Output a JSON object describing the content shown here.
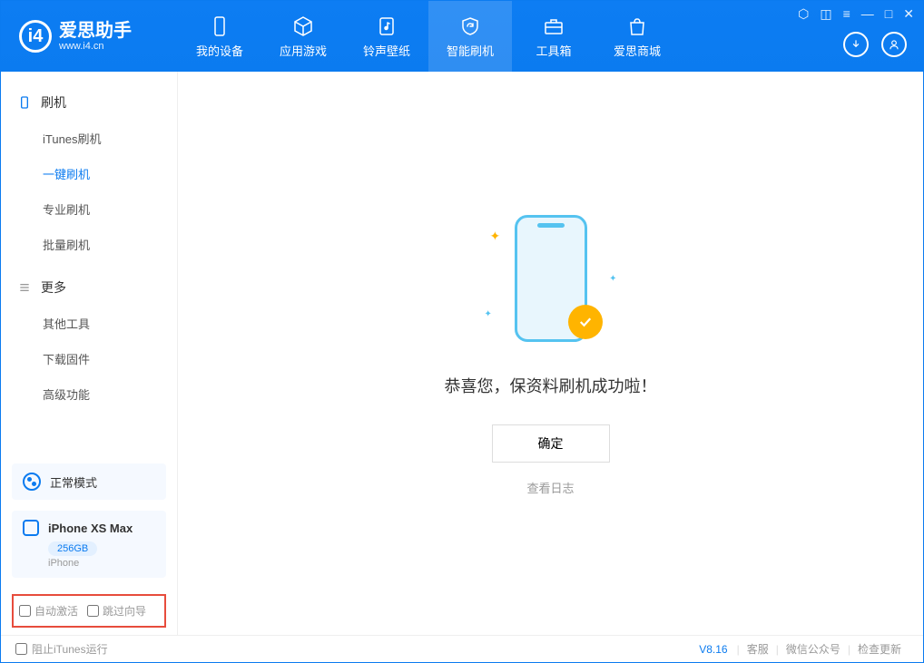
{
  "logo": {
    "title": "爱思助手",
    "subtitle": "www.i4.cn"
  },
  "tabs": {
    "device": "我的设备",
    "apps": "应用游戏",
    "ringtone": "铃声壁纸",
    "flash": "智能刷机",
    "toolbox": "工具箱",
    "store": "爱思商城"
  },
  "sidebar": {
    "section1_title": "刷机",
    "items1": {
      "itunes": "iTunes刷机",
      "onekey": "一键刷机",
      "pro": "专业刷机",
      "batch": "批量刷机"
    },
    "section2_title": "更多",
    "items2": {
      "other": "其他工具",
      "firmware": "下载固件",
      "advanced": "高级功能"
    }
  },
  "mode": {
    "label": "正常模式"
  },
  "device": {
    "name": "iPhone XS Max",
    "storage": "256GB",
    "type": "iPhone"
  },
  "options": {
    "auto_activate": "自动激活",
    "skip_guide": "跳过向导"
  },
  "main": {
    "success_msg": "恭喜您，保资料刷机成功啦！",
    "ok_btn": "确定",
    "log_link": "查看日志"
  },
  "footer": {
    "block_itunes": "阻止iTunes运行",
    "version": "V8.16",
    "support": "客服",
    "wechat": "微信公众号",
    "update": "检查更新"
  }
}
